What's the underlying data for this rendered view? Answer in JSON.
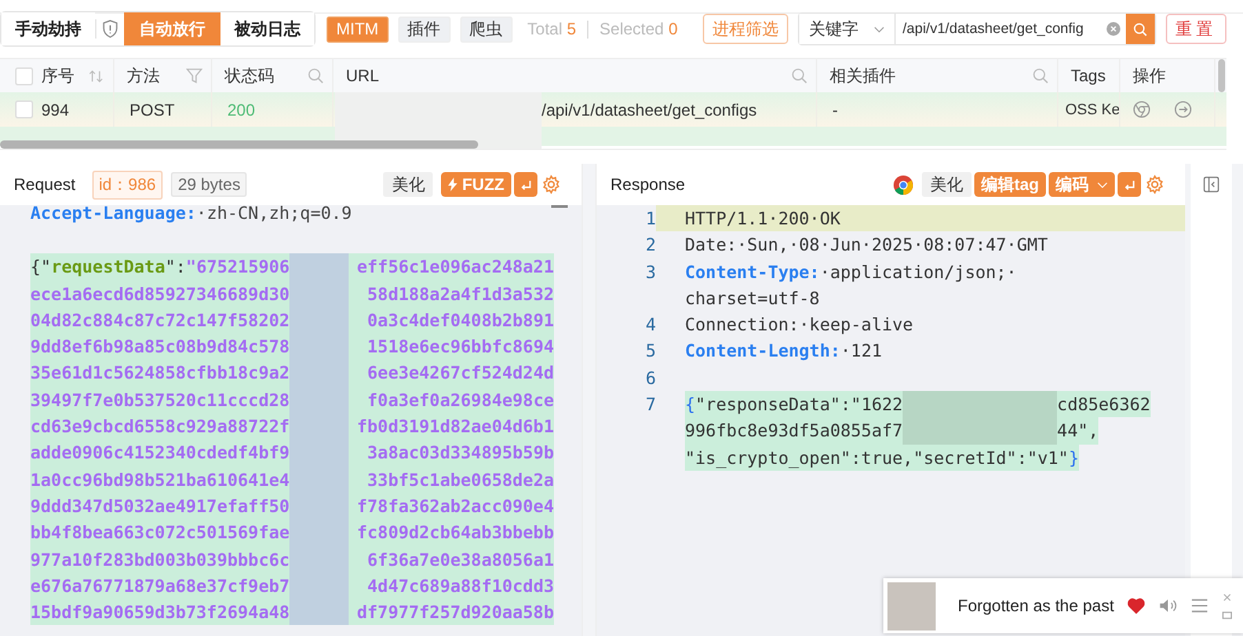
{
  "top_bar": {
    "mode_tabs": [
      {
        "label": "手动劫持",
        "selected": false
      },
      {
        "label": "自动放行",
        "selected": true
      },
      {
        "label": "被动日志",
        "selected": false
      }
    ],
    "filters": [
      {
        "label": "MITM",
        "selected": true
      },
      {
        "label": "插件",
        "selected": false
      },
      {
        "label": "爬虫",
        "selected": false
      }
    ],
    "total_label": "Total",
    "total": "5",
    "selected_label": "Selected",
    "selected_count": "0",
    "process_filter_button": "进程筛选",
    "search_type": "关键字",
    "search": {
      "value": "/api/v1/datasheet/get_config"
    },
    "reset_button": "重置"
  },
  "table": {
    "select_all_checked": false,
    "columns": [
      {
        "label": "序号",
        "kind": "sort"
      },
      {
        "label": "方法",
        "kind": "filter"
      },
      {
        "label": "状态码",
        "kind": "search"
      },
      {
        "label": "URL",
        "kind": "search"
      },
      {
        "label": "相关插件",
        "kind": "search"
      },
      {
        "label": "Tags",
        "kind": "plain"
      },
      {
        "label": "操作",
        "kind": "plain"
      }
    ],
    "rows": [
      {
        "checked": false,
        "cells": [
          "994",
          "POST",
          "200",
          "/api/v1/datasheet/get_configs",
          "-",
          "OSS Ke"
        ]
      }
    ]
  },
  "request": {
    "title": "Request",
    "id_badge": "id：986",
    "size": "29 bytes",
    "beautify": "美化",
    "fuzz": "FUZZ",
    "lines": [
      [
        {
          "kind": "header-name",
          "text": "Accept-Language:"
        },
        {
          "kind": "header-value",
          "text": "·zh-CN,zh;q=0.9"
        }
      ],
      [
        {
          "kind": "punct",
          "text": "{\""
        },
        {
          "kind": "key",
          "text": "requestData"
        },
        {
          "kind": "punct",
          "text": "\":"
        },
        {
          "kind": "hex",
          "text": "\"675215906"
        },
        {
          "kind": "redacted"
        },
        {
          "kind": "hex",
          "text": "eff56c1e096ac248a21"
        }
      ],
      [
        {
          "kind": "hex",
          "text": "ece1a6ecd6d85927346689d30"
        },
        {
          "kind": "redacted"
        },
        {
          "kind": "hex",
          "text": "58d188a2a4f1d3a532"
        }
      ],
      [
        {
          "kind": "hex",
          "text": "04d82c884c87c72c147f58202"
        },
        {
          "kind": "redacted"
        },
        {
          "kind": "hex",
          "text": "0a3c4def0408b2b891"
        }
      ],
      [
        {
          "kind": "hex",
          "text": "9dd8ef6b98a85c08b9d84c578"
        },
        {
          "kind": "redacted"
        },
        {
          "kind": "hex",
          "text": "1518e6ec96bbfc8694"
        }
      ],
      [
        {
          "kind": "hex",
          "text": "35e61d1c5624858cfbb18c9a2"
        },
        {
          "kind": "redacted"
        },
        {
          "kind": "hex",
          "text": "6ee3e4267cf524d24d"
        }
      ],
      [
        {
          "kind": "hex",
          "text": "39497f7e0b537520c11cccd28"
        },
        {
          "kind": "redacted"
        },
        {
          "kind": "hex",
          "text": "f0a3ef0a26984e98ce"
        }
      ],
      [
        {
          "kind": "hex",
          "text": "cd63e9cbcd6558c929a88722f"
        },
        {
          "kind": "redacted"
        },
        {
          "kind": "hex",
          "text": "fb0d3191d82ae04d6b1"
        }
      ],
      [
        {
          "kind": "hex",
          "text": "adde0906c4152340cdedf4bf9"
        },
        {
          "kind": "redacted"
        },
        {
          "kind": "hex",
          "text": "3a8ac03d334895b59b"
        }
      ],
      [
        {
          "kind": "hex",
          "text": "1a0cc96bd98b521ba610641e4"
        },
        {
          "kind": "redacted"
        },
        {
          "kind": "hex",
          "text": "33bf5c1abe0658de2a"
        }
      ],
      [
        {
          "kind": "hex",
          "text": "9ddd347d5032ae4917efaff50"
        },
        {
          "kind": "redacted"
        },
        {
          "kind": "hex",
          "text": "f78fa362ab2acc090e4"
        }
      ],
      [
        {
          "kind": "hex",
          "text": "bb4f8bea663c072c501569fae"
        },
        {
          "kind": "redacted"
        },
        {
          "kind": "hex",
          "text": "fc809d2cb64ab3bbebb"
        }
      ],
      [
        {
          "kind": "hex",
          "text": "977a10f283bd003b039bbbc6c"
        },
        {
          "kind": "redacted"
        },
        {
          "kind": "hex",
          "text": "6f36a7e0e38a8056a1"
        }
      ],
      [
        {
          "kind": "hex",
          "text": "e676a76771879a68e37cf9eb7"
        },
        {
          "kind": "redacted"
        },
        {
          "kind": "hex",
          "text": "4d47c689a88f10cdd3"
        }
      ],
      [
        {
          "kind": "hex",
          "text": "15bdf9a90659d3b73f2694a48"
        },
        {
          "kind": "redacted"
        },
        {
          "kind": "hex",
          "text": "df7977f257d920aa58b"
        }
      ]
    ]
  },
  "response": {
    "title": "Response",
    "beautify": "美化",
    "edit_tag": "编辑tag",
    "encoding": "编码",
    "lines": [
      {
        "number": "1",
        "active": true,
        "body": false,
        "segments": [
          {
            "kind": "text",
            "text": "HTTP/1.1·200·OK"
          }
        ]
      },
      {
        "number": "2",
        "active": false,
        "body": false,
        "segments": [
          {
            "kind": "text",
            "text": "Date:·Sun,·08·Jun·2025·08:07:47·GMT"
          }
        ]
      },
      {
        "number": "3",
        "active": false,
        "body": false,
        "segments": [
          {
            "kind": "header-name",
            "text": "Content-Type:"
          },
          {
            "kind": "text",
            "text": "·application/json;·"
          },
          {
            "kind": "break"
          },
          {
            "kind": "text",
            "text": "charset=utf-8"
          }
        ]
      },
      {
        "number": "4",
        "active": false,
        "body": false,
        "segments": [
          {
            "kind": "text",
            "text": "Connection:·keep-alive"
          }
        ]
      },
      {
        "number": "5",
        "active": false,
        "body": false,
        "segments": [
          {
            "kind": "header-name",
            "text": "Content-Length:"
          },
          {
            "kind": "text",
            "text": "·121"
          }
        ]
      },
      {
        "number": "6",
        "active": false,
        "body": false
      },
      {
        "number": "7",
        "active": false,
        "body": true,
        "segments": [
          {
            "kind": "brace",
            "text": "{"
          },
          {
            "kind": "text",
            "text": "\"responseData\":\"1622"
          },
          {
            "kind": "redacted"
          },
          {
            "kind": "text",
            "text": "cd85e6362"
          },
          {
            "kind": "break"
          },
          {
            "kind": "text",
            "text": "996fbc8e93df5a0855af7"
          },
          {
            "kind": "redacted"
          },
          {
            "kind": "text",
            "text": "44\","
          },
          {
            "kind": "break"
          },
          {
            "kind": "text",
            "text": "\"is_crypto_open\":true,\"secretId\":\"v1\""
          },
          {
            "kind": "brace",
            "text": "}"
          }
        ]
      }
    ]
  },
  "music_player": {
    "title": "Forgotten as the past",
    "liked": true
  }
}
